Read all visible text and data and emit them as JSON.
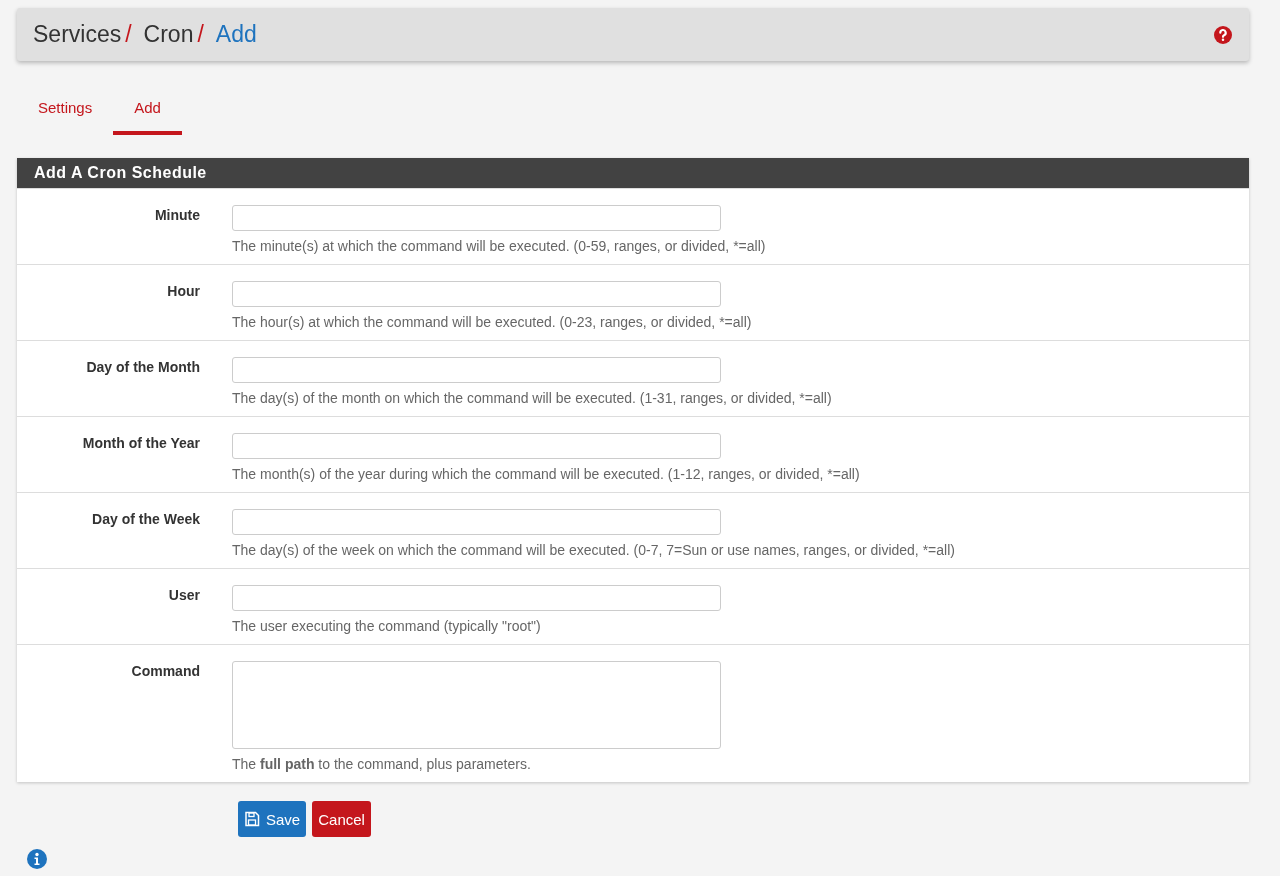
{
  "breadcrumb": {
    "separator": "/",
    "items": [
      {
        "label": "Services",
        "current": false
      },
      {
        "label": "Cron",
        "current": false
      },
      {
        "label": "Add",
        "current": true
      }
    ]
  },
  "tabs": [
    {
      "label": "Settings",
      "selected": false
    },
    {
      "label": "Add",
      "selected": true
    }
  ],
  "panel": {
    "title": "Add A Cron Schedule",
    "fields": [
      {
        "label": "Minute",
        "kind": "input",
        "help": "The minute(s) at which the command will be executed. (0-59, ranges, or divided, *=all)"
      },
      {
        "label": "Hour",
        "kind": "input",
        "help": "The hour(s) at which the command will be executed. (0-23, ranges, or divided, *=all)"
      },
      {
        "label": "Day of the Month",
        "kind": "input",
        "help": "The day(s) of the month on which the command will be executed. (1-31, ranges, or divided, *=all)"
      },
      {
        "label": "Month of the Year",
        "kind": "input",
        "help": "The month(s) of the year during which the command will be executed. (1-12, ranges, or divided, *=all)"
      },
      {
        "label": "Day of the Week",
        "kind": "input",
        "help": "The day(s) of the week on which the command will be executed. (0-7, 7=Sun or use names, ranges, or divided, *=all)"
      },
      {
        "label": "User",
        "kind": "input",
        "help": "The user executing the command (typically \"root\")"
      },
      {
        "label": "Command",
        "kind": "textarea",
        "help": "The **full path** to the command, plus parameters."
      }
    ]
  },
  "buttons": {
    "save": "Save",
    "cancel": "Cancel"
  }
}
